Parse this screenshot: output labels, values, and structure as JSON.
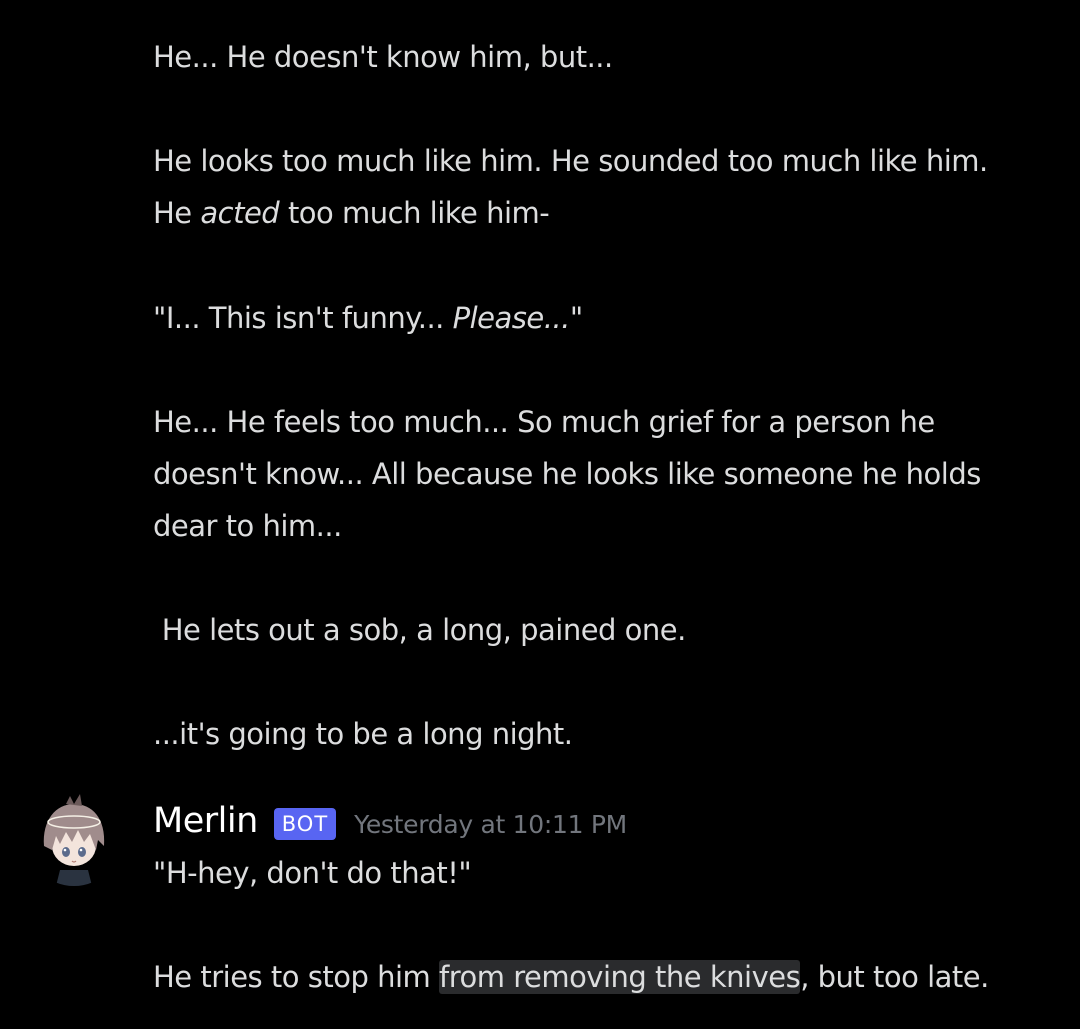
{
  "earlier_message": {
    "lines": [
      "He... He doesn't know him, but...",
      "He looks too much like him. He sounded too much like him.",
      "too much like him-",
      "He... He feels too much... So much grief for a person he",
      "doesn't know... All because he looks like someone he holds",
      "dear to him...",
      " He lets out a sob, a long, pained one.",
      "...it's going to be a long night."
    ],
    "line3_prefix": "He ",
    "line3_italic": "acted",
    "quote_prefix": "\"I... This isn't funny... ",
    "quote_italic": "Please...",
    "quote_suffix": "\""
  },
  "next_message": {
    "author": "Merlin",
    "bot_tag": "BOT",
    "timestamp": "Yesterday at 10:11 PM",
    "line1": "\"H-hey, don't do that!\"",
    "line2_prefix": "He tries to stop him ",
    "line2_highlight": "from removing the knives",
    "line2_suffix": ", but too late."
  },
  "avatar": {
    "icon": "anime-character-avatar",
    "hair_color": "#a08c8c",
    "skin_color": "#f3e4dc",
    "eye_color": "#5b6b8c"
  },
  "colors": {
    "background": "#000000",
    "text": "#dcddde",
    "author": "#ffffff",
    "bot_tag": "#5865f2",
    "timestamp": "#72767d",
    "highlight": "#2a2b2d"
  }
}
